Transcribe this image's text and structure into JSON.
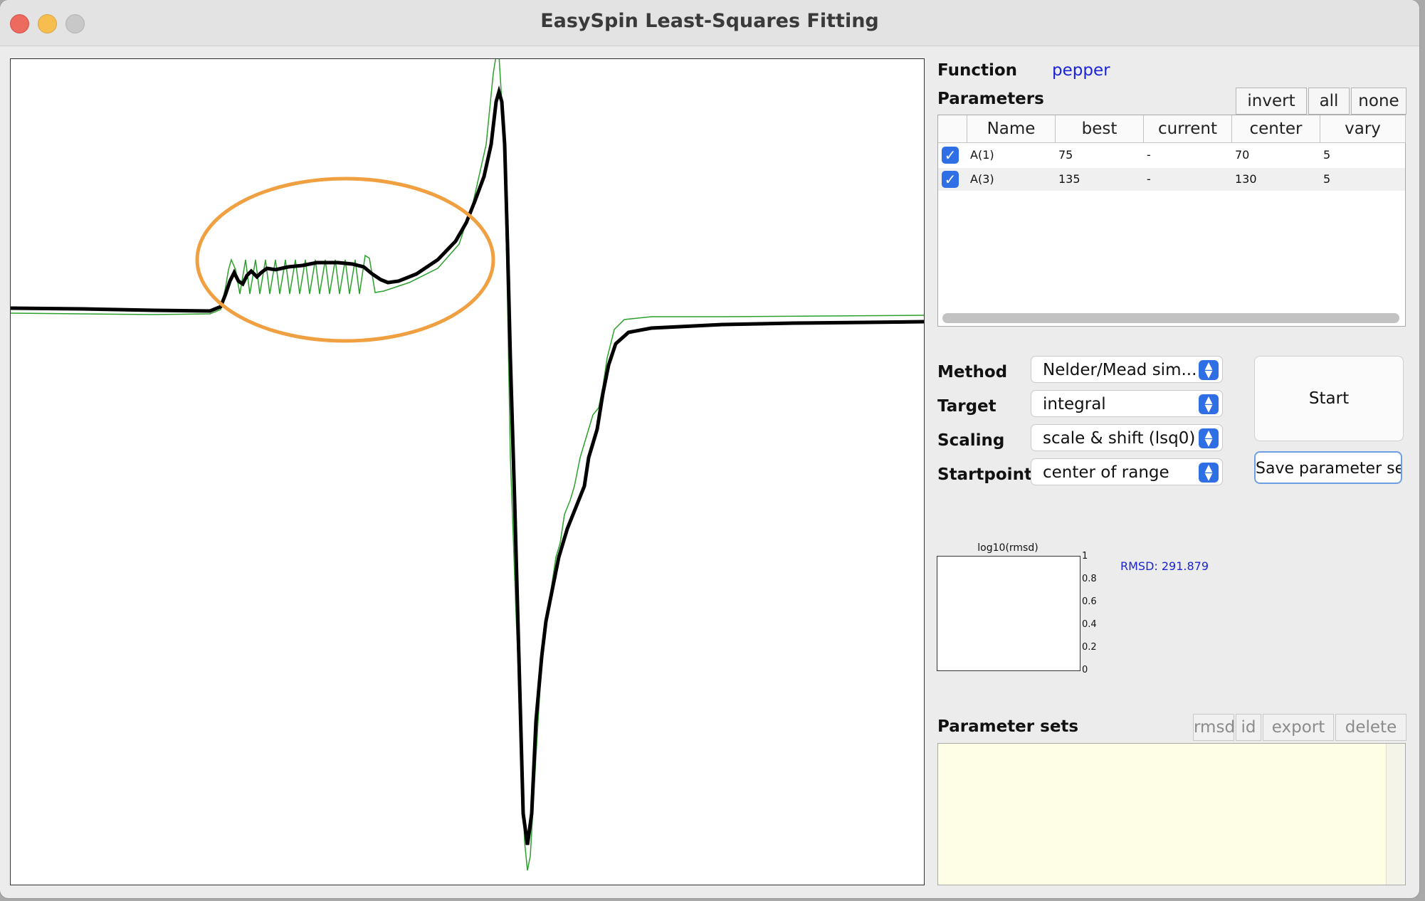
{
  "window": {
    "title": "EasySpin Least-Squares Fitting"
  },
  "function": {
    "label": "Function",
    "value": "pepper"
  },
  "parameters": {
    "label": "Parameters",
    "buttons": [
      "invert",
      "all",
      "none"
    ],
    "columns": [
      "Name",
      "best",
      "current",
      "center",
      "vary"
    ],
    "rows": [
      {
        "checked": true,
        "name": "A(1)",
        "best": "75",
        "current": "-",
        "center": "70",
        "vary": "5"
      },
      {
        "checked": true,
        "name": "A(3)",
        "best": "135",
        "current": "-",
        "center": "130",
        "vary": "5"
      }
    ]
  },
  "settings": {
    "method": {
      "label": "Method",
      "value": "Nelder/Mead sim..."
    },
    "target": {
      "label": "Target",
      "value": "integral"
    },
    "scaling": {
      "label": "Scaling",
      "value": "scale & shift (lsq0)"
    },
    "startpoint": {
      "label": "Startpoint",
      "value": "center of range"
    }
  },
  "actions": {
    "start": "Start",
    "save": "Save parameter set"
  },
  "rmsd_plot": {
    "title": "log10(rmsd)",
    "yticks": [
      "1",
      "0.8",
      "0.6",
      "0.4",
      "0.2",
      "0"
    ],
    "rmsd_text": "RMSD: 291.879"
  },
  "parameter_sets": {
    "label": "Parameter sets",
    "buttons": [
      "rmsd",
      "id",
      "export",
      "delete"
    ]
  },
  "colors": {
    "experimental": "#000000",
    "simulated": "#2ca02c",
    "annotation": "#f0a040",
    "link_blue": "#1a23d6",
    "accent_blue": "#2f6fe6"
  }
}
